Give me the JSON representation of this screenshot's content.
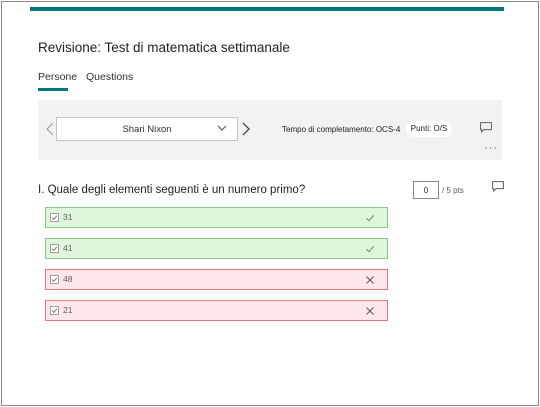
{
  "header": {
    "title": "Revisione: Test di matematica settimanale",
    "accent_color": "#03787c"
  },
  "tabs": [
    {
      "label": "Persone",
      "active": true
    },
    {
      "label": "Questions",
      "active": false
    }
  ],
  "respondent": {
    "prev_icon": "chevron-left-icon",
    "next_icon": "chevron-right-icon",
    "selected_name": "Shari Nixon",
    "dropdown_icon": "chevron-down-icon",
    "completion_text": "Tempo di completamento: OCS-4",
    "points_text": "Punti: O/S",
    "comment_icon": "comment-icon",
    "more_icon": "more-icon",
    "more_glyph": "···"
  },
  "question": {
    "text": "I. Quale degli elementi seguenti è un numero primo?",
    "score_value": "0",
    "score_max_text": "/ 5 pts",
    "comment_icon": "comment-icon",
    "options": [
      {
        "label": "31",
        "status": "correct",
        "result_icon": "check-icon"
      },
      {
        "label": "41",
        "status": "correct",
        "result_icon": "check-icon"
      },
      {
        "label": "48",
        "status": "wrong",
        "result_icon": "close-icon"
      },
      {
        "label": "21",
        "status": "wrong",
        "result_icon": "close-icon"
      }
    ]
  },
  "colors": {
    "correct_bg": "#dff6dd",
    "correct_border": "#8cc78c",
    "wrong_bg": "#fde7e9",
    "wrong_border": "#e27a7a"
  }
}
